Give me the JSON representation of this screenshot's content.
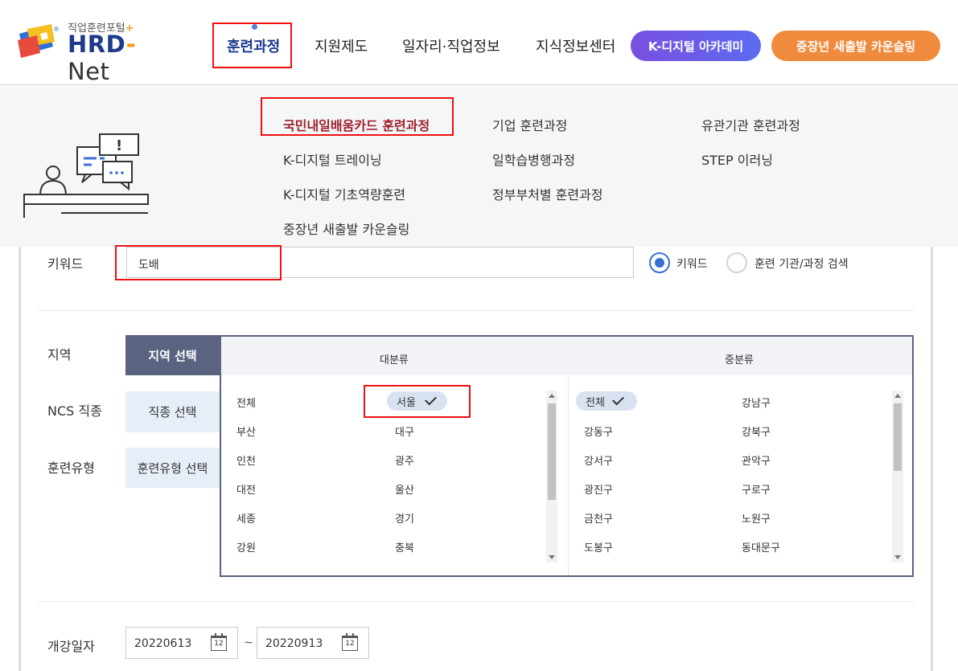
{
  "header": {
    "logo": {
      "subtitle": "직업훈련포털",
      "plus": "+",
      "name_hrd": "HRD",
      "name_dash": "-",
      "name_net": " Net"
    },
    "nav": [
      {
        "label": "훈련과정"
      },
      {
        "label": "지원제도"
      },
      {
        "label": "일자리·직업정보"
      },
      {
        "label": "지식정보센터"
      }
    ],
    "pills": {
      "digital": "K-디지털 아카데미",
      "counseling": "중장년 새출발 카운슬링"
    }
  },
  "mega_menu": {
    "col1": [
      "국민내일배움카드 훈련과정",
      "K-디지털 트레이닝",
      "K-디지털 기초역량훈련",
      "중장년 새출발 카운슬링"
    ],
    "col2": [
      "기업 훈련과정",
      "일학습병행과정",
      "정부부처별 훈련과정"
    ],
    "col3": [
      "유관기관 훈련과정",
      "STEP 이러닝"
    ]
  },
  "search": {
    "keyword_label": "키워드",
    "keyword_value": "도배",
    "radio_keyword": "키워드",
    "radio_institution": "훈련 기관/과정 검색"
  },
  "filters": {
    "region_label": "지역",
    "ncs_label": "NCS 직종",
    "type_label": "훈련유형",
    "region_btn": "지역 선택",
    "ncs_btn": "직종 선택",
    "type_btn": "훈련유형 선택"
  },
  "picker": {
    "major_header": "대분류",
    "minor_header": "중분류",
    "major": [
      [
        "전체",
        "서울"
      ],
      [
        "부산",
        "대구"
      ],
      [
        "인천",
        "광주"
      ],
      [
        "대전",
        "울산"
      ],
      [
        "세종",
        "경기"
      ],
      [
        "강원",
        "충북"
      ]
    ],
    "minor": [
      [
        "전체",
        "강남구"
      ],
      [
        "강동구",
        "강북구"
      ],
      [
        "강서구",
        "관악구"
      ],
      [
        "광진구",
        "구로구"
      ],
      [
        "금천구",
        "노원구"
      ],
      [
        "도봉구",
        "동대문구"
      ]
    ]
  },
  "dates": {
    "label": "개강일자",
    "start": "20220613",
    "end": "20220913",
    "separator": "~",
    "cal_day": "12"
  }
}
